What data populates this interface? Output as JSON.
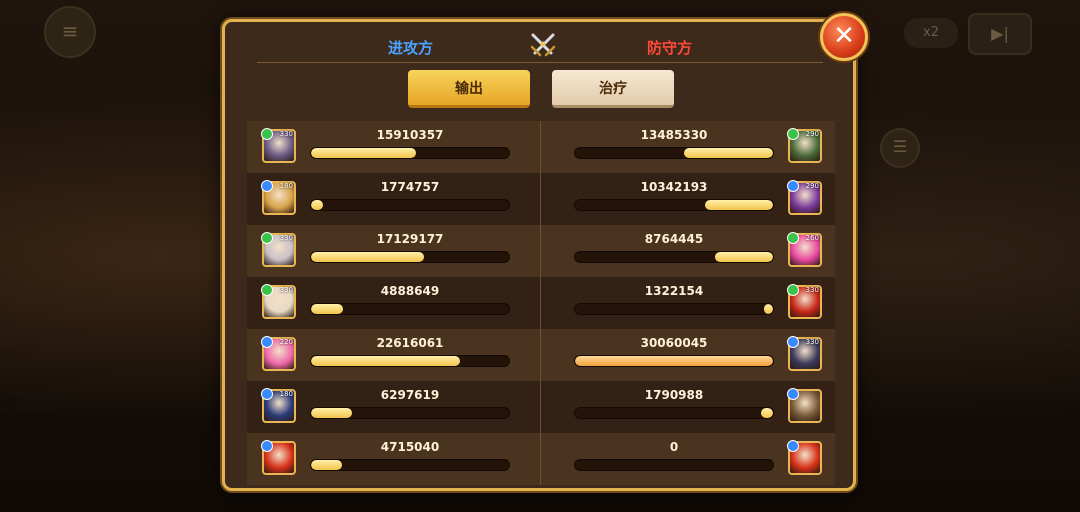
{
  "header": {
    "attacker_label": "进攻方",
    "defender_label": "防守方"
  },
  "tabs": {
    "output_label": "输出",
    "heal_label": "治疗",
    "active": "output"
  },
  "background": {
    "speed_label": "x2"
  },
  "colors": {
    "attacker": "#4aa3ff",
    "defender": "#ff4a3a",
    "panel_border": "#e2b24f",
    "bar_fill": "#f3c44b",
    "close_button": "#d63b17"
  },
  "max_value": 30060045,
  "rows": [
    {
      "attacker": {
        "value": "15910357",
        "level": "330",
        "hue": "#6a5a86"
      },
      "defender": {
        "value": "13485330",
        "level": "290",
        "hue": "#4a6a3a"
      }
    },
    {
      "attacker": {
        "value": "1774757",
        "level": "180",
        "hue": "#d8a24a"
      },
      "defender": {
        "value": "10342193",
        "level": "290",
        "hue": "#7a3a9a"
      }
    },
    {
      "attacker": {
        "value": "17129177",
        "level": "330",
        "hue": "#c9c0c8"
      },
      "defender": {
        "value": "8764445",
        "level": "260",
        "hue": "#e94aa0"
      }
    },
    {
      "attacker": {
        "value": "4888649",
        "level": "330",
        "hue": "#e8d9c4"
      },
      "defender": {
        "value": "1322154",
        "level": "330",
        "hue": "#c9281a"
      }
    },
    {
      "attacker": {
        "value": "22616061",
        "level": "220",
        "hue": "#f06aa8"
      },
      "defender": {
        "value": "30060045",
        "level": "330",
        "hue": "#3a3a5a"
      }
    },
    {
      "attacker": {
        "value": "6297619",
        "level": "180",
        "hue": "#2a3a7a"
      },
      "defender": {
        "value": "1790988",
        "level": "",
        "hue": "#7a5a3a"
      }
    },
    {
      "attacker": {
        "value": "4715040",
        "level": "",
        "hue": "#d8321a"
      },
      "defender": {
        "value": "0",
        "level": "",
        "hue": "#d8321a"
      }
    }
  ]
}
